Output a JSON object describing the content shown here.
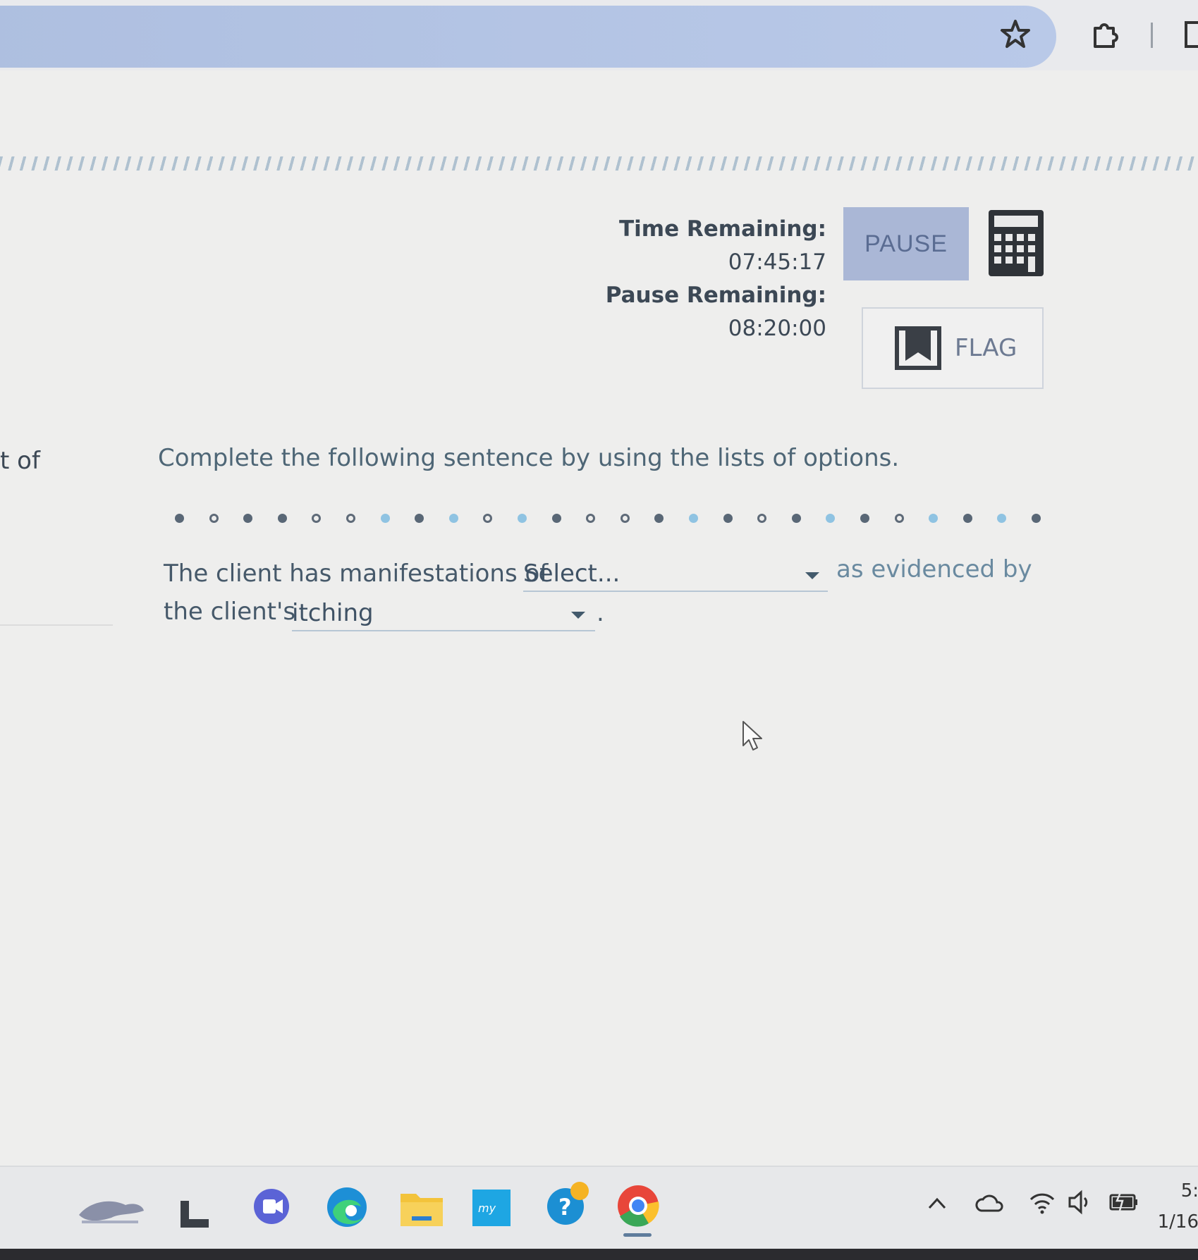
{
  "timers": {
    "time_label": "Time Remaining:",
    "time_value": "07:45:17",
    "pause_label": "Pause Remaining:",
    "pause_value": "08:20:00"
  },
  "toolbar": {
    "pause_label": "PAUSE",
    "flag_label": "FLAG"
  },
  "left_fragment": "t of",
  "question": {
    "instruction": "Complete the following sentence by using the lists of options.",
    "sentence_part1": "The client has manifestations of",
    "select1_value": "Select...",
    "sentence_part2": "as evidenced by",
    "sentence_part3": "the client's",
    "select2_value": "itching",
    "sentence_end": "."
  },
  "progress_dots": [
    "filled",
    "hollow",
    "filled",
    "filled",
    "hollow",
    "hollow",
    "blue",
    "filled",
    "blue",
    "hollow",
    "blue",
    "filled",
    "hollow",
    "hollow",
    "filled",
    "blue",
    "filled",
    "hollow",
    "filled",
    "blue",
    "filled",
    "hollow",
    "blue",
    "filled",
    "blue",
    "filled"
  ],
  "clock": {
    "time": "5:",
    "date": "1/16"
  },
  "colors": {
    "pause_bg": "#aab7d6",
    "omnibox": "#b4c4e6",
    "dot_blue": "#8fc3e2"
  }
}
